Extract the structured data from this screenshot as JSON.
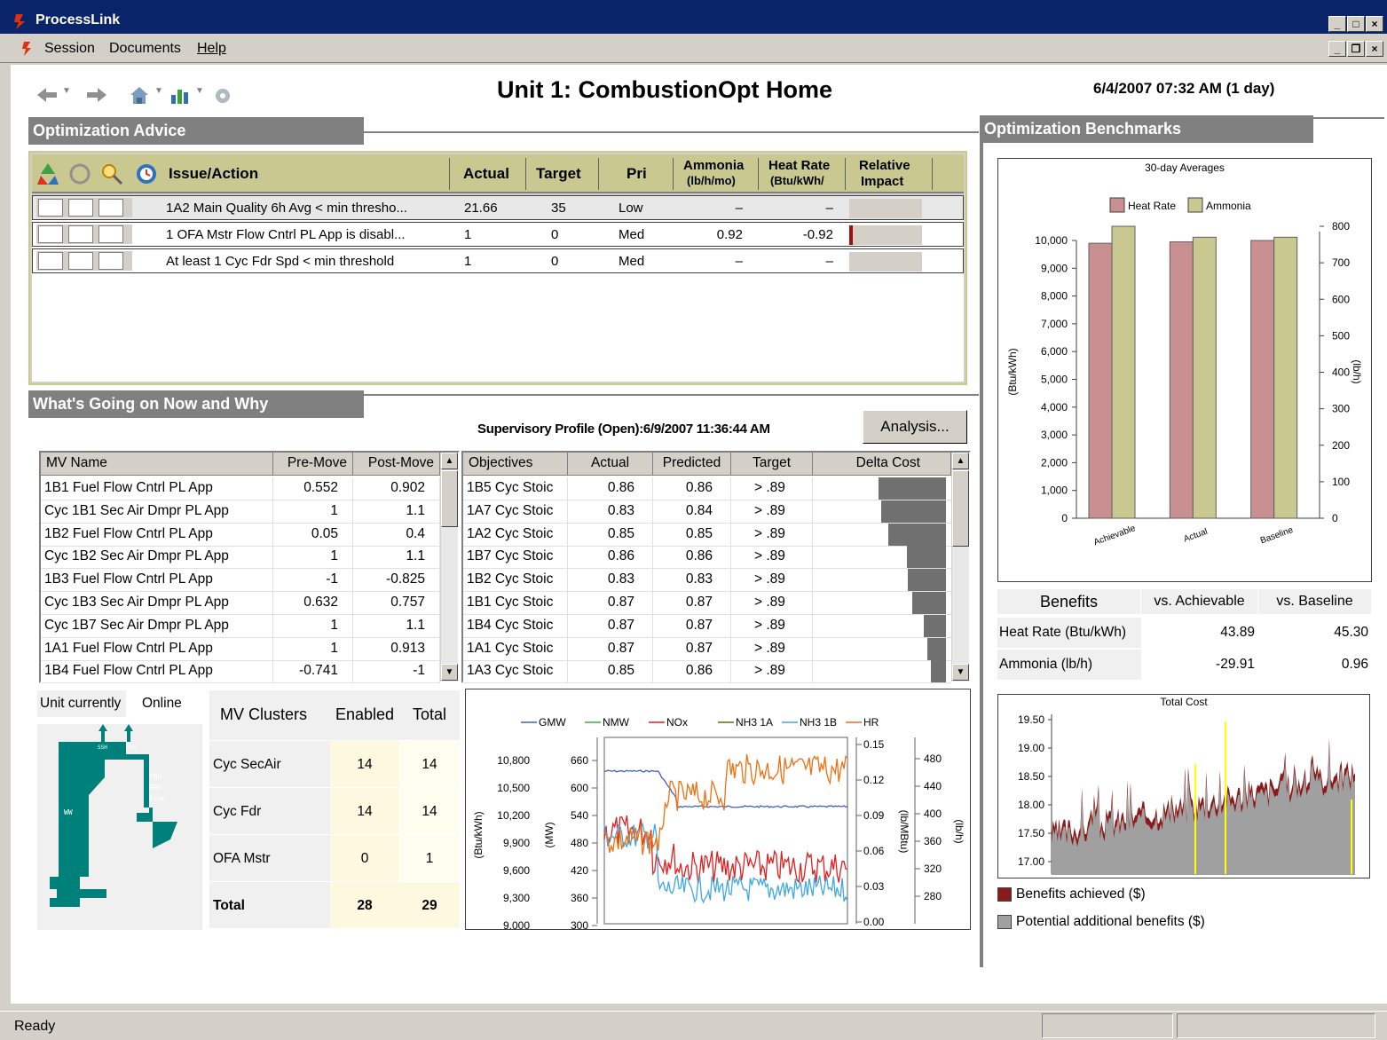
{
  "window": {
    "title": "ProcessLink"
  },
  "menu": {
    "session": "Session",
    "documents": "Documents",
    "help": "Help"
  },
  "page_title": "Unit 1: CombustionOpt Home",
  "datetime": "6/4/2007 07:32 AM (1 day)",
  "sections": {
    "advice": "Optimization Advice",
    "now_why": "What's Going on Now and Why",
    "benchmarks": "Optimization Benchmarks"
  },
  "advice_table": {
    "headers": {
      "issue": "Issue/Action",
      "actual": "Actual",
      "target": "Target",
      "pri": "Pri",
      "ammonia": "Ammonia",
      "ammonia_unit": "(lb/h/mo)",
      "heatrate": "Heat Rate",
      "heatrate_unit": "(Btu/kWh/",
      "impact": "Relative",
      "impact2": "Impact"
    },
    "rows": [
      {
        "issue": "1A2  Main Quality 6h Avg < min thresho...",
        "actual": "21.66",
        "target": "35",
        "pri": "Low",
        "ammonia": "–",
        "heatrate": "–",
        "impact": 0
      },
      {
        "issue": "1 OFA Mstr Flow Cntrl PL App is disabl...",
        "actual": "1",
        "target": "0",
        "pri": "Med",
        "ammonia": "0.92",
        "heatrate": "-0.92",
        "impact": 0.05
      },
      {
        "issue": "At least 1 Cyc Fdr Spd < min threshold",
        "actual": "1",
        "target": "0",
        "pri": "Med",
        "ammonia": "–",
        "heatrate": "–",
        "impact": 0
      }
    ]
  },
  "supervisory_profile": "Supervisory Profile (Open):6/9/2007 11:36:44 AM",
  "analysis_button": "Analysis...",
  "mv_table": {
    "headers": [
      "MV Name",
      "Pre-Move",
      "Post-Move"
    ],
    "rows": [
      [
        "1B1 Fuel Flow Cntrl PL App",
        "0.552",
        "0.902"
      ],
      [
        "Cyc 1B1 Sec Air Dmpr PL App",
        "1",
        "1.1"
      ],
      [
        "1B2 Fuel Flow Cntrl PL App",
        "0.05",
        "0.4"
      ],
      [
        "Cyc 1B2 Sec Air Dmpr PL App",
        "1",
        "1.1"
      ],
      [
        "1B3 Fuel Flow Cntrl PL App",
        "-1",
        "-0.825"
      ],
      [
        "Cyc 1B3 Sec Air Dmpr PL App",
        "0.632",
        "0.757"
      ],
      [
        "Cyc 1B7 Sec Air Dmpr PL App",
        "1",
        "1.1"
      ],
      [
        "1A1 Fuel Flow Cntrl PL App",
        "1",
        "0.913"
      ],
      [
        "1B4 Fuel Flow Cntrl PL App",
        "-0.741",
        "-1"
      ]
    ]
  },
  "obj_table": {
    "headers": [
      "Objectives",
      "Actual",
      "Predicted",
      "Target",
      "Delta Cost"
    ],
    "rows": [
      [
        "1B5 Cyc Stoic",
        "0.86",
        "0.86",
        "> .89"
      ],
      [
        "1A7 Cyc Stoic",
        "0.83",
        "0.84",
        "> .89"
      ],
      [
        "1A2 Cyc Stoic",
        "0.85",
        "0.85",
        "> .89"
      ],
      [
        "1B7 Cyc Stoic",
        "0.86",
        "0.86",
        "> .89"
      ],
      [
        "1B2 Cyc Stoic",
        "0.83",
        "0.83",
        "> .89"
      ],
      [
        "1B1 Cyc Stoic",
        "0.87",
        "0.87",
        "> .89"
      ],
      [
        "1B4 Cyc Stoic",
        "0.87",
        "0.87",
        "> .89"
      ],
      [
        "1A1 Cyc Stoic",
        "0.87",
        "0.87",
        "> .89"
      ],
      [
        "1A3 Cyc Stoic",
        "0.85",
        "0.86",
        "> .89"
      ]
    ],
    "delta_cost": [
      1.0,
      0.96,
      0.86,
      0.58,
      0.56,
      0.5,
      0.33,
      0.27,
      0.22
    ]
  },
  "unit_status": {
    "label": "Unit currently",
    "value": "Online"
  },
  "boiler_labels": {
    "ww": "WW",
    "pbh": "PBH",
    "hrh": "HRH",
    "econ": "Econ",
    "ssh": "SSH",
    "prh": "PRH"
  },
  "clusters": {
    "headers": [
      "MV Clusters",
      "Enabled",
      "Total"
    ],
    "rows": [
      [
        "Cyc SecAir",
        "14",
        "14"
      ],
      [
        "Cyc Fdr",
        "14",
        "14"
      ],
      [
        "OFA Mstr",
        "0",
        "1"
      ]
    ],
    "total": [
      "Total",
      "28",
      "29"
    ]
  },
  "trend": {
    "legend": [
      "GMW",
      "NMW",
      "NOx",
      "NH3 1A",
      "NH3 1B",
      "HR"
    ],
    "colors": [
      "#4060c0",
      "#40b040",
      "#e02020",
      "#6b6b00",
      "#40a8e0",
      "#f07010"
    ],
    "left1_label": "(Btu/kWh)",
    "left1_ticks": [
      "10,800",
      "10,500",
      "10,200",
      "9,900",
      "9,600",
      "9,300",
      "9,000"
    ],
    "left2_label": "(MW)",
    "left2_ticks": [
      "660",
      "600",
      "540",
      "480",
      "420",
      "360",
      "300"
    ],
    "right1_label": "(lb/MBtu)",
    "right1_ticks": [
      "0.15",
      "0.12",
      "0.09",
      "0.06",
      "0.03",
      "0.00"
    ],
    "right2_label": "(lb/h)",
    "right2_ticks": [
      "480",
      "440",
      "400",
      "360",
      "320",
      "280"
    ]
  },
  "chart_data": [
    {
      "type": "bar",
      "title": "30-day Averages",
      "categories": [
        "Achievable",
        "Actual",
        "Baseline"
      ],
      "series": [
        {
          "name": "Heat Rate",
          "values": [
            9900,
            9950,
            10000
          ],
          "color": "#c89090",
          "axis": "left"
        },
        {
          "name": "Ammonia",
          "values": [
            810,
            770,
            770
          ],
          "color": "#c8c890",
          "axis": "right"
        }
      ],
      "ylabel": "(Btu/kWh)",
      "y2label": "(lb/h)",
      "ylim": [
        0,
        10000
      ],
      "y2lim": [
        0,
        800
      ],
      "yticks": [
        "10,000",
        "9,000",
        "8,000",
        "7,000",
        "6,000",
        "5,000",
        "4,000",
        "3,000",
        "2,000",
        "1,000",
        "0"
      ],
      "y2ticks": [
        "800",
        "700",
        "600",
        "500",
        "400",
        "300",
        "200",
        "100",
        "0"
      ]
    },
    {
      "type": "area",
      "title": "Total Cost",
      "ylim": [
        17.0,
        19.5
      ],
      "yticks": [
        "19.50",
        "19.00",
        "18.50",
        "18.00",
        "17.50",
        "17.00"
      ],
      "legend": [
        "Benefits achieved ($)",
        "Potential additional benefits ($)"
      ],
      "colors": [
        "#8b1a1a",
        "#a0a0a0",
        "#ffff00"
      ]
    }
  ],
  "benefits": {
    "headers": [
      "Benefits",
      "vs. Achievable",
      "vs. Baseline"
    ],
    "rows": [
      [
        "Heat Rate (Btu/kWh)",
        "43.89",
        "45.30"
      ],
      [
        "Ammonia (lb/h)",
        "-29.91",
        "0.96"
      ]
    ]
  },
  "status": {
    "text": "Ready"
  }
}
